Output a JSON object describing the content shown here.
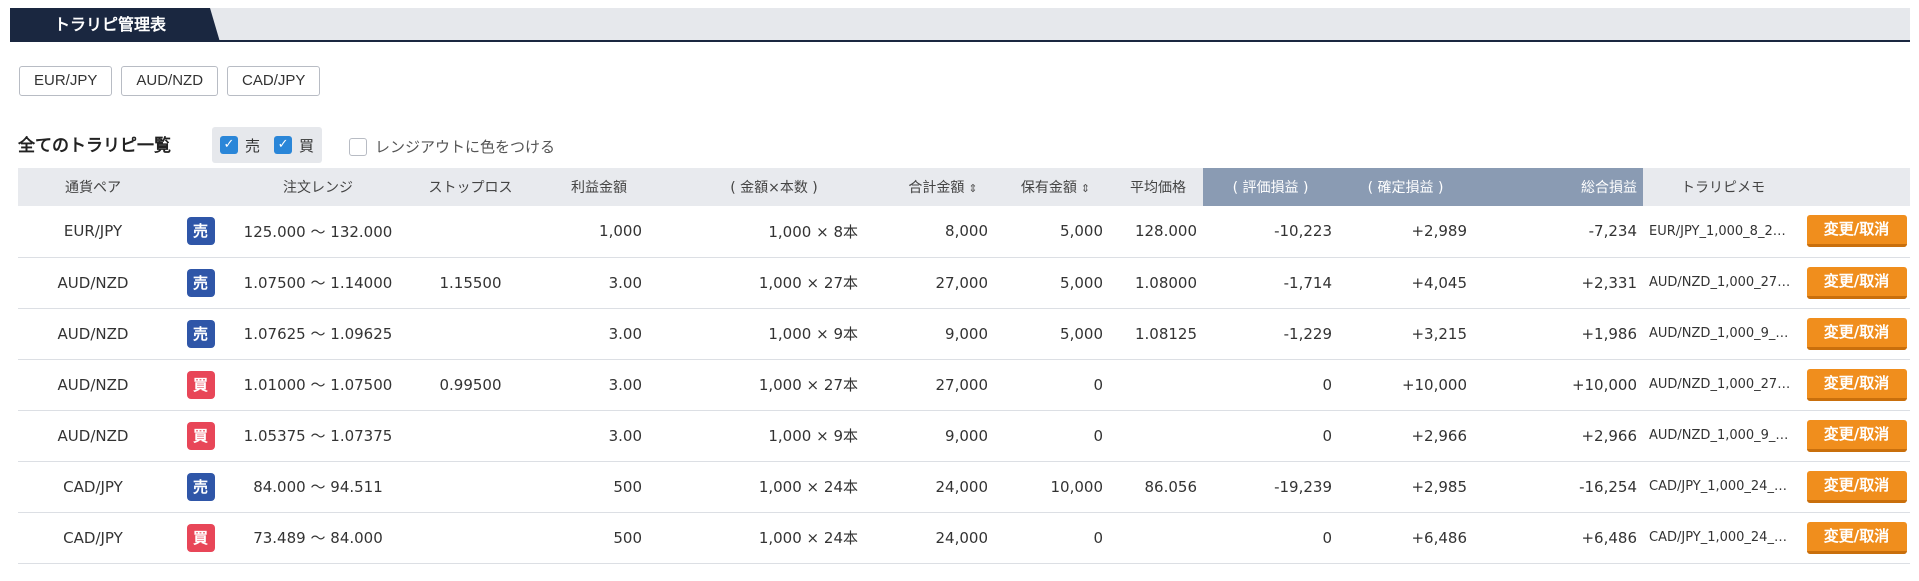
{
  "header": {
    "tab_title": "トラリピ管理表"
  },
  "pair_buttons": [
    "EUR/JPY",
    "AUD/NZD",
    "CAD/JPY"
  ],
  "list": {
    "title": "全てのトラリピ一覧",
    "filter_sell": "売",
    "filter_buy": "買",
    "range_out_label": "レンジアウトに色をつける"
  },
  "columns": {
    "pair": "通貨ペア",
    "order_range": "注文レンジ",
    "stop_loss": "ストップロス",
    "profit_amount": "利益金額",
    "amount_count": "( 金額×本数 )",
    "total_amount": "合計金額",
    "holding_amount": "保有金額",
    "avg_price": "平均価格",
    "unrealized_pl": "( 評価損益 )",
    "realized_pl": "( 確定損益 )",
    "total_pl": "総合損益",
    "memo": "トラリピメモ"
  },
  "action_label": "変更/取消",
  "range_sep": "〜",
  "times": "×",
  "rows": [
    {
      "pair": "EUR/JPY",
      "side": "売",
      "side_type": "sell",
      "range_low": "125.000",
      "range_high": "132.000",
      "stop_loss": "",
      "profit": "1,000",
      "unit": "1,000",
      "count": "8本",
      "total": "8,000",
      "holding": "5,000",
      "avg": "128.000",
      "unrealized": "-10,223",
      "unrealized_neg": true,
      "realized": "+2,989",
      "total_pl": "-7,234",
      "total_pl_neg": true,
      "memo": "EUR/JPY_1,000_8_2…"
    },
    {
      "pair": "AUD/NZD",
      "side": "売",
      "side_type": "sell",
      "range_low": "1.07500",
      "range_high": "1.14000",
      "stop_loss": "1.15500",
      "profit": "3.00",
      "unit": "1,000",
      "count": "27本",
      "total": "27,000",
      "holding": "5,000",
      "avg": "1.08000",
      "unrealized": "-1,714",
      "unrealized_neg": true,
      "realized": "+4,045",
      "total_pl": "+2,331",
      "total_pl_neg": false,
      "memo": "AUD/NZD_1,000_27…"
    },
    {
      "pair": "AUD/NZD",
      "side": "売",
      "side_type": "sell",
      "range_low": "1.07625",
      "range_high": "1.09625",
      "stop_loss": "",
      "profit": "3.00",
      "unit": "1,000",
      "count": "9本",
      "total": "9,000",
      "holding": "5,000",
      "avg": "1.08125",
      "unrealized": "-1,229",
      "unrealized_neg": true,
      "realized": "+3,215",
      "total_pl": "+1,986",
      "total_pl_neg": false,
      "memo": "AUD/NZD_1,000_9_…"
    },
    {
      "pair": "AUD/NZD",
      "side": "買",
      "side_type": "buy",
      "range_low": "1.01000",
      "range_high": "1.07500",
      "stop_loss": "0.99500",
      "profit": "3.00",
      "unit": "1,000",
      "count": "27本",
      "total": "27,000",
      "holding": "0",
      "avg": "",
      "unrealized": "0",
      "unrealized_neg": false,
      "realized": "+10,000",
      "total_pl": "+10,000",
      "total_pl_neg": false,
      "memo": "AUD/NZD_1,000_27…"
    },
    {
      "pair": "AUD/NZD",
      "side": "買",
      "side_type": "buy",
      "range_low": "1.05375",
      "range_high": "1.07375",
      "stop_loss": "",
      "profit": "3.00",
      "unit": "1,000",
      "count": "9本",
      "total": "9,000",
      "holding": "0",
      "avg": "",
      "unrealized": "0",
      "unrealized_neg": false,
      "realized": "+2,966",
      "total_pl": "+2,966",
      "total_pl_neg": false,
      "memo": "AUD/NZD_1,000_9_…"
    },
    {
      "pair": "CAD/JPY",
      "side": "売",
      "side_type": "sell",
      "range_low": "84.000",
      "range_high": "94.511",
      "stop_loss": "",
      "profit": "500",
      "unit": "1,000",
      "count": "24本",
      "total": "24,000",
      "holding": "10,000",
      "avg": "86.056",
      "unrealized": "-19,239",
      "unrealized_neg": true,
      "realized": "+2,985",
      "total_pl": "-16,254",
      "total_pl_neg": true,
      "memo": "CAD/JPY_1,000_24_…"
    },
    {
      "pair": "CAD/JPY",
      "side": "買",
      "side_type": "buy",
      "range_low": "73.489",
      "range_high": "84.000",
      "stop_loss": "",
      "profit": "500",
      "unit": "1,000",
      "count": "24本",
      "total": "24,000",
      "holding": "0",
      "avg": "",
      "unrealized": "0",
      "unrealized_neg": false,
      "realized": "+6,486",
      "total_pl": "+6,486",
      "total_pl_neg": false,
      "memo": "CAD/JPY_1,000_24_…"
    }
  ]
}
